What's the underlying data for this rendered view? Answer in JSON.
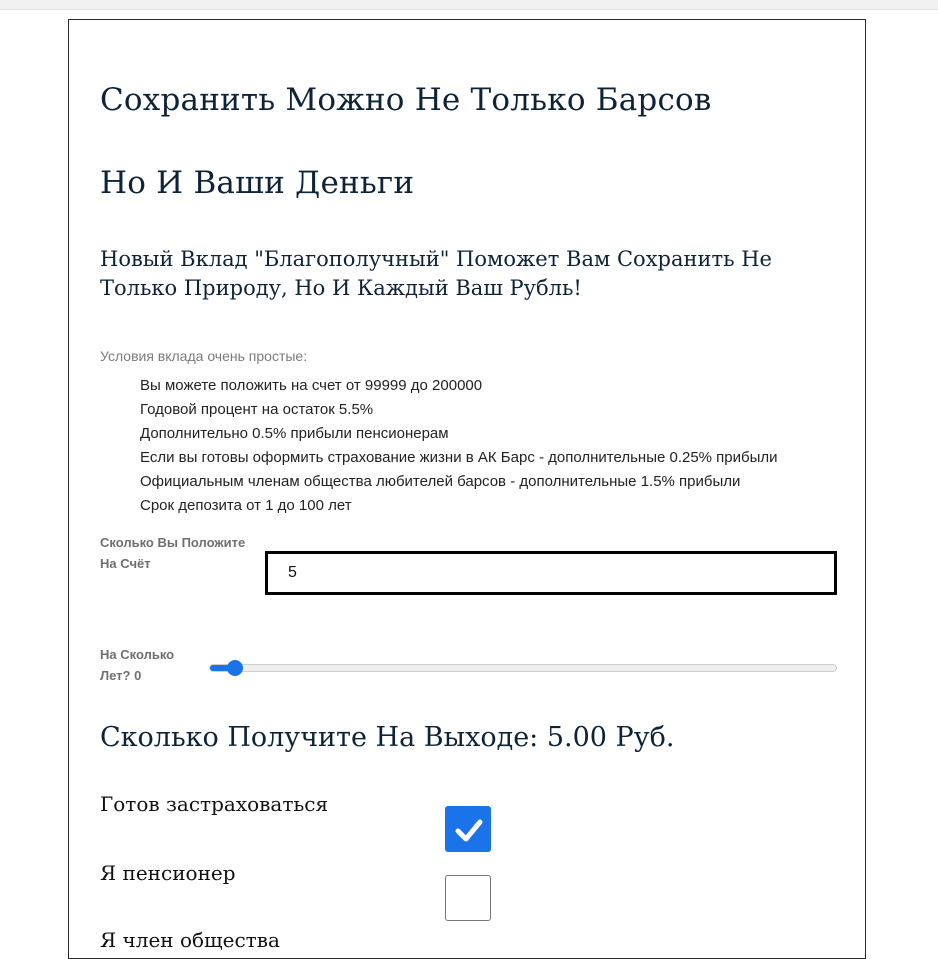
{
  "header": {
    "title_line1": "Сохранить Можно Не Только Барсов",
    "title_line2": "Но И Ваши Деньги",
    "subtitle": "Новый Вклад \"Благополучный\" Поможет Вам Сохранить Не Только Природу, Но И Каждый Ваш Рубль!"
  },
  "conditions": {
    "title": "Условия вклада очень простые:",
    "items": [
      "Вы можете положить на счет от 99999 до 200000",
      "Годовой процент на остаток 5.5%",
      "Дополнительно 0.5% прибыли пенсионерам",
      "Если вы готовы оформить страхование жизни в АК Барс - дополнительные 0.25% прибыли",
      "Официальным членам общества любителей барсов - дополнительные 1.5% прибыли",
      "Срок депозита от 1 до 100 лет"
    ]
  },
  "form": {
    "amount_label": "Сколько Вы Положите На Счёт",
    "amount_value": "5",
    "years_label": "На Сколько Лет? 0",
    "years_slider": {
      "min": 0,
      "max": 100,
      "value": 4
    }
  },
  "result": {
    "text": "Сколько Получите На Выходе: 5.00 Руб."
  },
  "options": {
    "insurance_label": "Готов застраховаться",
    "insurance_checked": true,
    "pensioner_label": "Я пенсионер",
    "pensioner_checked": false,
    "next_label_partial": "Я член общества"
  },
  "colors": {
    "accent": "#1a73e8",
    "heading": "#0f2336"
  }
}
